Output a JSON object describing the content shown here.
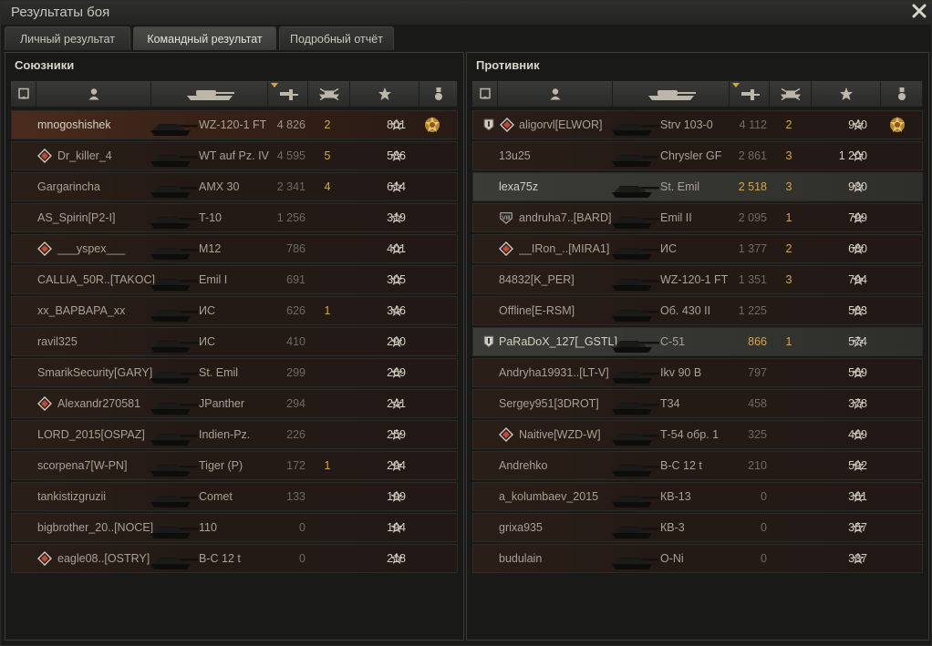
{
  "window": {
    "title": "Результаты боя"
  },
  "tabs": [
    {
      "label": "Личный результат",
      "active": false
    },
    {
      "label": "Командный результат",
      "active": true
    },
    {
      "label": "Подробный отчёт",
      "active": false
    }
  ],
  "allies": {
    "title": "Союзники",
    "rows": [
      {
        "name": "mnogoshishek",
        "tank": "WZ-120-1 FT",
        "damage": "4 826",
        "frags": "2",
        "xp": "801",
        "medal": true,
        "style": "self"
      },
      {
        "name": "Dr_killer_4",
        "badge": "diamond",
        "tank": "WT auf Pz. IV",
        "damage": "4 595",
        "frags": "5",
        "xp": "586"
      },
      {
        "name": "Gargarincha",
        "tank": "AMX 30",
        "damage": "2 341",
        "frags": "4",
        "xp": "614"
      },
      {
        "name": "AS_Spirin[P2-I]",
        "tank": "T-10",
        "damage": "1 256",
        "frags": "",
        "xp": "319"
      },
      {
        "name": "___yspex___",
        "badge": "diamond",
        "tank": "M12",
        "damage": "786",
        "frags": "",
        "xp": "401"
      },
      {
        "name": "CALLIA_50R..[TAKOC]",
        "tank": "Emil I",
        "damage": "691",
        "frags": "",
        "xp": "305"
      },
      {
        "name": "xx_BAPBAPA_xx",
        "tank": "ИС",
        "damage": "626",
        "frags": "1",
        "xp": "346"
      },
      {
        "name": "ravil325",
        "tank": "ИС",
        "damage": "410",
        "frags": "",
        "xp": "290"
      },
      {
        "name": "SmarikSecurity[GARY]",
        "tank": "St. Emil",
        "damage": "299",
        "frags": "",
        "xp": "269"
      },
      {
        "name": "Alexandr270581",
        "badge": "diamond",
        "tank": "JPanther",
        "damage": "294",
        "frags": "",
        "xp": "241"
      },
      {
        "name": "LORD_2015[OSPAZ]",
        "tank": "Indien-Pz.",
        "damage": "226",
        "frags": "",
        "xp": "259"
      },
      {
        "name": "scorpena7[W-PN]",
        "tank": "Tiger (P)",
        "damage": "172",
        "frags": "1",
        "xp": "294"
      },
      {
        "name": "tankistizgruzii",
        "tank": "Comet",
        "damage": "133",
        "frags": "",
        "xp": "199"
      },
      {
        "name": "bigbrother_20..[NOCE]",
        "tank": "110",
        "damage": "0",
        "frags": "",
        "xp": "194"
      },
      {
        "name": "eagle08..[OSTRY]",
        "badge": "diamond",
        "tank": "B-C 12 t",
        "damage": "0",
        "frags": "",
        "xp": "218"
      }
    ]
  },
  "enemies": {
    "title": "Противник",
    "rows": [
      {
        "name": "aligorvl[ELWOR]",
        "badge": "diamond",
        "rank": true,
        "tank": "Strv 103-0",
        "damage": "4 112",
        "frags": "2",
        "xp": "940",
        "medal": true
      },
      {
        "name": "13u25",
        "tank": "Chrysler GF",
        "damage": "2 861",
        "frags": "3",
        "xp": "1 200"
      },
      {
        "name": "lexa75z",
        "tank": "St. Emil",
        "damage": "2 518",
        "frags": "3",
        "xp": "930",
        "style": "hl"
      },
      {
        "name": "andruha7..[BARD]",
        "badge": "viii",
        "tank": "Emil II",
        "damage": "2 095",
        "frags": "1",
        "xp": "799"
      },
      {
        "name": "__IRon_..[MIRA1]",
        "badge": "diamond",
        "tank": "ИС",
        "damage": "1 377",
        "frags": "2",
        "xp": "680"
      },
      {
        "name": "84832[K_PER]",
        "tank": "WZ-120-1 FT",
        "damage": "1 351",
        "frags": "3",
        "xp": "794"
      },
      {
        "name": "Offline[E-RSM]",
        "tank": "Об. 430 II",
        "damage": "1 225",
        "frags": "",
        "xp": "583"
      },
      {
        "name": "PaRaDoX_127[_GSTL]",
        "rank": true,
        "tank": "С-51",
        "damage": "866",
        "frags": "1",
        "xp": "574",
        "style": "hl"
      },
      {
        "name": "Andryha19931..[LT-V]",
        "tank": "Ikv 90 B",
        "damage": "797",
        "frags": "",
        "xp": "569"
      },
      {
        "name": "Sergey951[3DROT]",
        "tank": "T34",
        "damage": "458",
        "frags": "",
        "xp": "378"
      },
      {
        "name": "Naitive[WZD-W]",
        "badge": "diamond",
        "tank": "Т-54 обр. 1",
        "damage": "325",
        "frags": "",
        "xp": "469"
      },
      {
        "name": "Andrehko",
        "tank": "B-C 12 t",
        "damage": "210",
        "frags": "",
        "xp": "592"
      },
      {
        "name": "a_kolumbaev_2015",
        "tank": "КВ-13",
        "damage": "0",
        "frags": "",
        "xp": "361"
      },
      {
        "name": "grixa935",
        "tank": "КВ-3",
        "damage": "0",
        "frags": "",
        "xp": "357"
      },
      {
        "name": "budulain",
        "tank": "O-Ni",
        "damage": "0",
        "frags": "",
        "xp": "337"
      }
    ]
  },
  "colors": {
    "accent": "#d7a744",
    "text": "#bfb8a8",
    "row_bg": "#241a15",
    "self_row": "#4a2c1c"
  },
  "icons": [
    "close-icon",
    "platoon-icon",
    "player-icon",
    "tank-icon",
    "damage-icon",
    "frags-icon",
    "xp-star-icon",
    "medal-icon"
  ]
}
